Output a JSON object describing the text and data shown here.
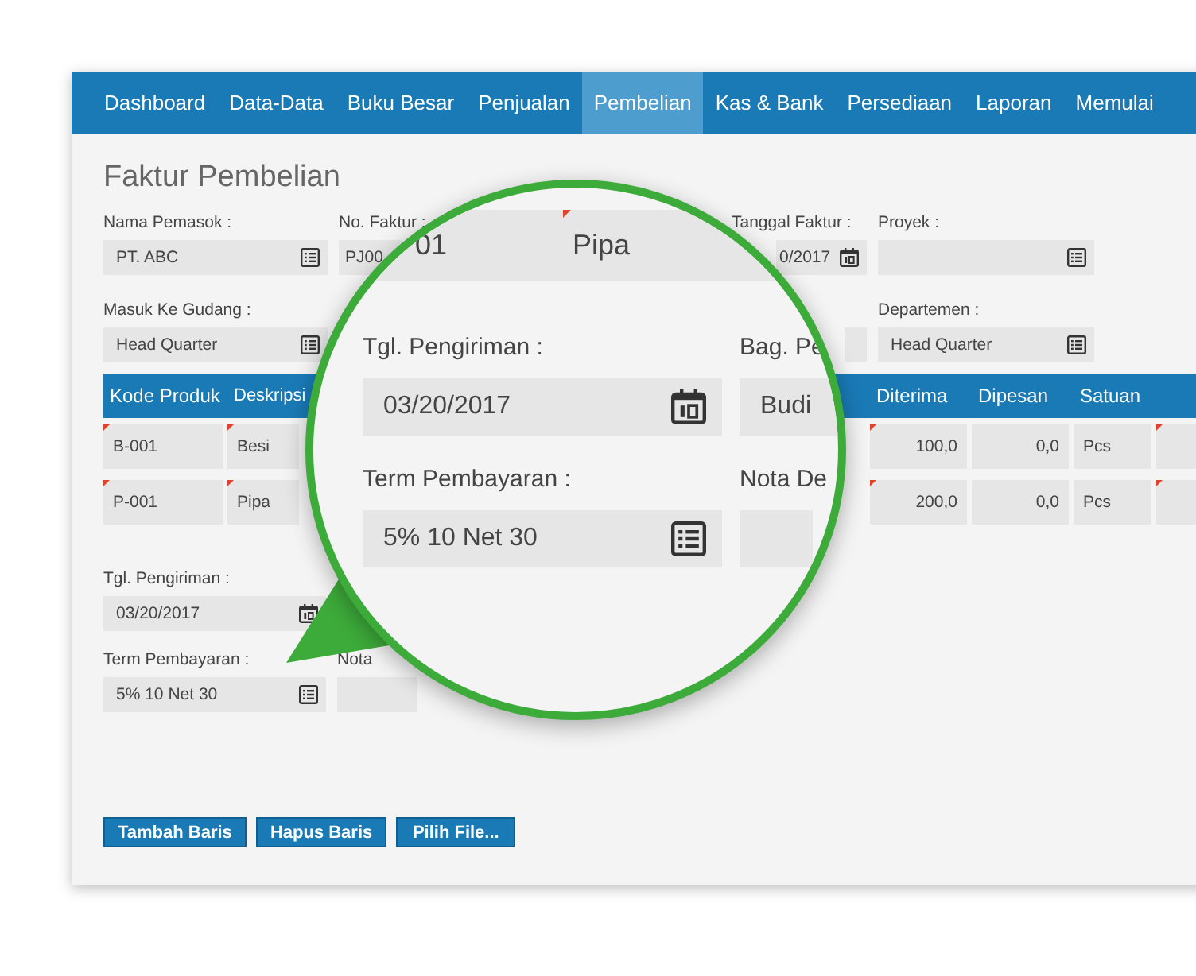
{
  "nav": [
    {
      "label": "Dashboard",
      "selected": false
    },
    {
      "label": "Data-Data",
      "selected": false
    },
    {
      "label": "Buku Besar",
      "selected": false
    },
    {
      "label": "Penjualan",
      "selected": false
    },
    {
      "label": "Pembelian",
      "selected": true
    },
    {
      "label": "Kas & Bank",
      "selected": false
    },
    {
      "label": "Persediaan",
      "selected": false
    },
    {
      "label": "Laporan",
      "selected": false
    },
    {
      "label": "Memulai",
      "selected": false
    }
  ],
  "title": "Faktur Pembelian",
  "header_rows": [
    [
      {
        "label": "Nama Pemasok :",
        "value": "PT. ABC",
        "kind": "list"
      },
      {
        "label": "No. Faktur :",
        "value": "PJ00",
        "kind": "text"
      },
      {
        "label": "Tanggal Faktur :",
        "value": "0/2017",
        "kind": "date"
      },
      {
        "label": "Proyek :",
        "kind": "list"
      }
    ],
    [
      {
        "label": "Masuk Ke Gudang :",
        "value": "Head Quarter",
        "kind": "list"
      },
      {
        "kind": "stub"
      },
      {
        "label": "Departemen :",
        "value": "Head Quarter",
        "kind": "list"
      }
    ]
  ],
  "table": {
    "columns": [
      {
        "label": "Kode Produk",
        "kind": "text"
      },
      {
        "label": "Deskripsi",
        "kind": "text"
      },
      {
        "label": "Diterima",
        "kind": "number"
      },
      {
        "label": "Dipesan",
        "kind": "number"
      },
      {
        "label": "Satuan",
        "kind": "text"
      }
    ],
    "rows": [
      {
        "cells": [
          "B-001",
          "Besi",
          "100,0",
          "0,0",
          "Pcs"
        ]
      },
      {
        "cells": [
          "P-001",
          "Pipa",
          "200,0",
          "0,0",
          "Pcs"
        ]
      }
    ]
  },
  "footer_fields": [
    [
      {
        "label": "Tgl. Pengiriman :",
        "value": "03/20/2017",
        "kind": "date"
      }
    ],
    [
      {
        "label": "Term Pembayaran :",
        "value": "5% 10 Net 30",
        "kind": "list"
      },
      {
        "label": "Nota",
        "kind": "text"
      }
    ]
  ],
  "buttons": [
    "Tambah Baris",
    "Hapus Baris",
    "Pilih File..."
  ],
  "magnifier": {
    "row_fragment": [
      "01",
      "Pipa"
    ],
    "fields": [
      [
        {
          "label": "Tgl. Pengiriman :",
          "value": "03/20/2017",
          "kind": "date"
        },
        {
          "label": "Bag. Pe",
          "value": "Budi",
          "kind": "text"
        }
      ],
      [
        {
          "label": "Term Pembayaran :",
          "value": "5% 10 Net 30",
          "kind": "list"
        },
        {
          "label": "Nota De",
          "kind": "text"
        }
      ]
    ]
  }
}
